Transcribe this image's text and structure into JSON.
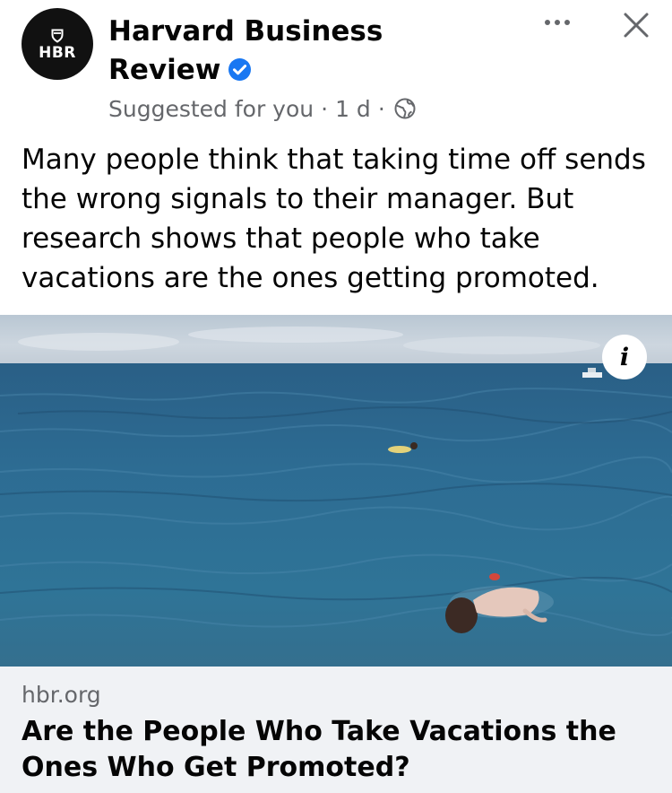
{
  "post": {
    "author": {
      "name": "Harvard Business Review",
      "avatar_text": "HBR",
      "verified": true
    },
    "meta": {
      "suggestion": "Suggested for you",
      "time": "1 d",
      "separator": "·",
      "audience_icon": "globe-icon"
    },
    "actions": {
      "more_icon": "more-horizontal-icon",
      "close_icon": "close-icon"
    },
    "text": "Many people think that taking time off sends the wrong signals to their manager. But research shows that people who take vacations are the ones getting promoted.",
    "image": {
      "info_label": "i"
    },
    "link": {
      "domain": "hbr.org",
      "title": "Are the People Who Take Vacations the Ones Who Get Promoted?"
    }
  },
  "colors": {
    "text_primary": "#050505",
    "text_secondary": "#65676b",
    "verified_blue": "#1877f2",
    "link_background": "#f0f2f5",
    "avatar_background": "#111111"
  }
}
